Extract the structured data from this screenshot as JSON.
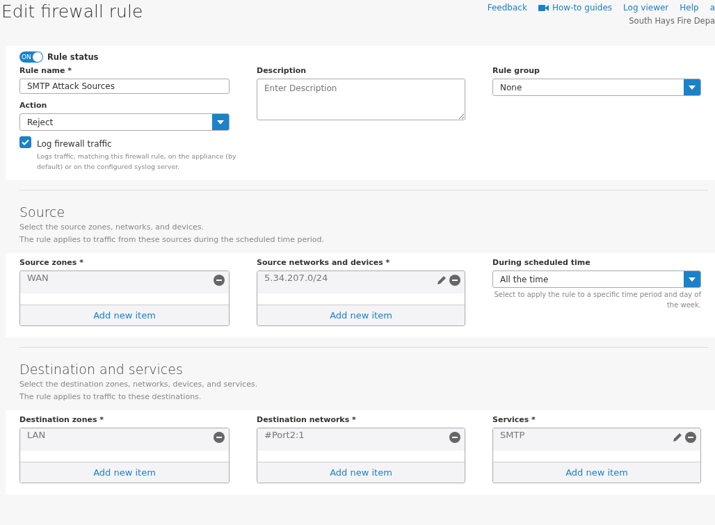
{
  "title": "Edit firewall rule",
  "header_links": [
    {
      "label": "Feedback",
      "kind": "link"
    },
    {
      "label": "How-to guides",
      "kind": "video"
    },
    {
      "label": "Log viewer",
      "kind": "link"
    },
    {
      "label": "Help",
      "kind": "link"
    },
    {
      "label": "a",
      "kind": "link"
    }
  ],
  "account": "South Hays Fire Depa",
  "rule_status": {
    "label": "Rule status",
    "on": true,
    "state_text": "ON"
  },
  "rule_name": {
    "label": "Rule name *",
    "value": "SMTP Attack Sources"
  },
  "description": {
    "label": "Description",
    "placeholder": "Enter Description"
  },
  "rule_group": {
    "label": "Rule group",
    "value": "None"
  },
  "action": {
    "label": "Action",
    "value": "Reject"
  },
  "log_traffic": {
    "label": "Log firewall traffic",
    "checked": true,
    "hint": "Logs traffic, matching this firewall rule, on the appliance (by default) or on the configured syslog server."
  },
  "sections": [
    {
      "title": "Source",
      "subtitles": [
        "Select the source zones, networks, and devices.",
        "The rule applies to traffic from these sources during the scheduled time period."
      ],
      "fields": [
        {
          "kind": "list",
          "label": "Source zones *",
          "items": [
            {
              "text": "WAN",
              "editable": false
            }
          ],
          "add": "Add new item"
        },
        {
          "kind": "list",
          "label": "Source networks and devices *",
          "items": [
            {
              "text": "5.34.207.0/24",
              "editable": true
            }
          ],
          "add": "Add new item"
        },
        {
          "kind": "select",
          "label": "During scheduled time",
          "value": "All the time",
          "hint": "Select to apply the rule to a specific time period and day of the week."
        }
      ]
    },
    {
      "title": "Destination and services",
      "subtitles": [
        "Select the destination zones, networks, devices, and services.",
        "The rule applies to traffic to these destinations."
      ],
      "fields": [
        {
          "kind": "list",
          "label": "Destination zones *",
          "items": [
            {
              "text": "LAN",
              "editable": false
            }
          ],
          "add": "Add new item"
        },
        {
          "kind": "list",
          "label": "Destination networks *",
          "items": [
            {
              "text": "#Port2:1",
              "editable": false
            }
          ],
          "add": "Add new item"
        },
        {
          "kind": "list",
          "label": "Services *",
          "items": [
            {
              "text": "SMTP",
              "editable": true
            }
          ],
          "add": "Add new item"
        }
      ]
    }
  ]
}
